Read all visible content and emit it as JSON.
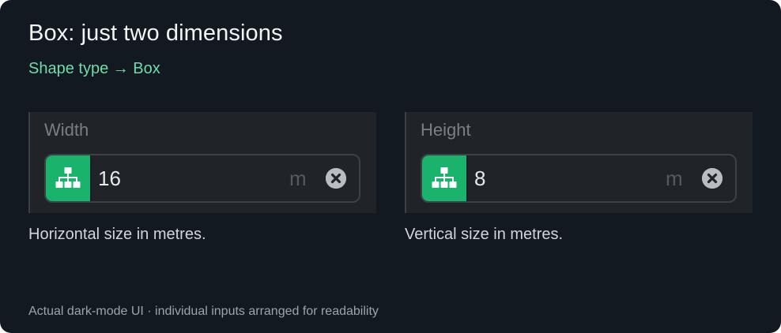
{
  "card": {
    "title": "Box: just two dimensions",
    "subtitle": "Shape type → Box",
    "footer": "Actual dark-mode UI · individual inputs arranged for readability"
  },
  "fields": [
    {
      "label": "Width",
      "value": "16",
      "unit": "m",
      "help": "Horizontal size in metres.",
      "prefix_icon": "hierarchy-icon",
      "clear_icon": "clear-icon"
    },
    {
      "label": "Height",
      "value": "8",
      "unit": "m",
      "help": "Vertical size in metres.",
      "prefix_icon": "hierarchy-icon",
      "clear_icon": "clear-icon"
    }
  ],
  "colors": {
    "background": "#121920",
    "accent": "#19b36c",
    "subtitle": "#6fdca8"
  }
}
